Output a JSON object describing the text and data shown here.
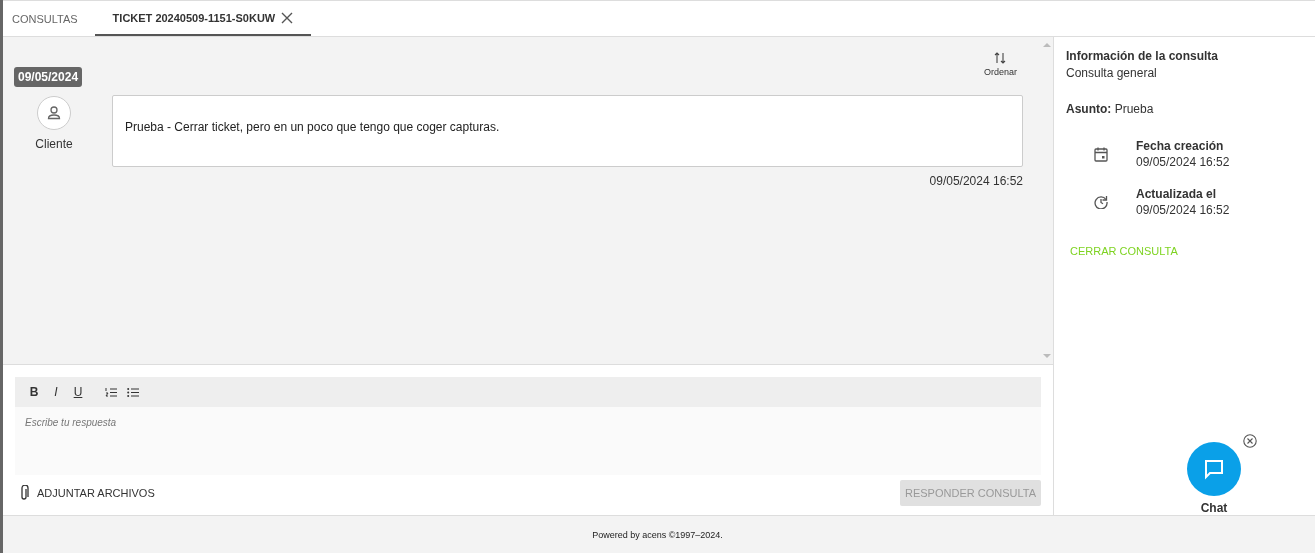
{
  "tabs": [
    {
      "label": "CONSULTAS",
      "selected": false,
      "closable": false
    },
    {
      "label": "TICKET 20240509-1151-S0KUW",
      "selected": true,
      "closable": true
    }
  ],
  "sort_button": {
    "label": "Ordenar"
  },
  "date_chip": "09/05/2024",
  "messages": [
    {
      "author": "Cliente",
      "text": "Prueba - Cerrar ticket, pero en un poco que tengo que coger capturas.",
      "time": "09/05/2024 16:52"
    }
  ],
  "editor": {
    "toolbar": [
      {
        "kind": "bold",
        "label": "B"
      },
      {
        "kind": "italic",
        "label": "I"
      },
      {
        "kind": "underline",
        "label": "U"
      },
      {
        "kind": "ordered-list"
      },
      {
        "kind": "bullet-list"
      }
    ],
    "placeholder": "Escribe tu respuesta"
  },
  "attach_button": "ADJUNTAR ARCHIVOS",
  "reply_button": {
    "label": "RESPONDER CONSULTA",
    "disabled": true
  },
  "info": {
    "title": "Información de la consulta",
    "category": "Consulta general",
    "subject_label": "Asunto:",
    "subject": "Prueba",
    "dates": [
      {
        "kind": "created",
        "label": "Fecha creación",
        "value": "09/05/2024 16:52"
      },
      {
        "kind": "updated",
        "label": "Actualizada el",
        "value": "09/05/2024 16:52"
      }
    ],
    "close_link": "CERRAR CONSULTA"
  },
  "chat": {
    "label": "Chat"
  },
  "footer": "Powered by acens ©1997–2024."
}
